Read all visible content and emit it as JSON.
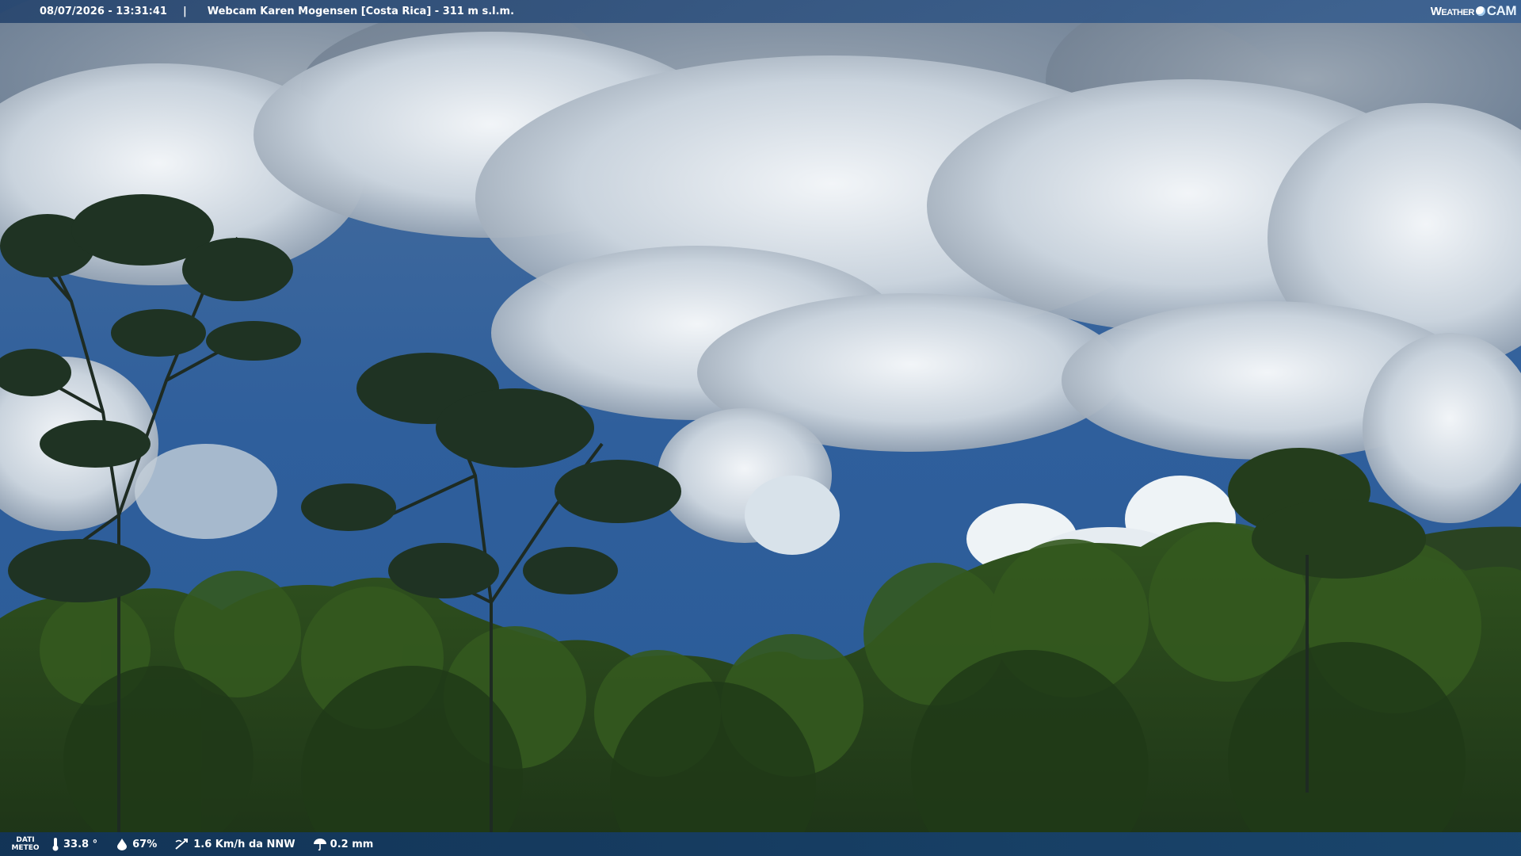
{
  "overlay": {
    "timestamp": "08/07/2026 - 13:31:41",
    "separator": "|",
    "title": "Webcam Karen Mogensen [Costa Rica]  - 311 m s.l.m.",
    "brand": {
      "weather": "Weather",
      "cam": "CAM"
    }
  },
  "weather_bar": {
    "label_line1": "DATI",
    "label_line2": "METEO",
    "temperature": "33.8 °",
    "humidity": "67%",
    "wind": "1.6 Km/h da NNW",
    "rain": "0.2 mm",
    "icons": [
      "thermometer-icon",
      "humidity-drop-icon",
      "wind-icon",
      "rain-umbrella-icon"
    ]
  },
  "colors": {
    "sky": "#2f5c94",
    "cloud": "#e6edf3",
    "forest": "#27451d",
    "bar": "#1f4a7a"
  }
}
